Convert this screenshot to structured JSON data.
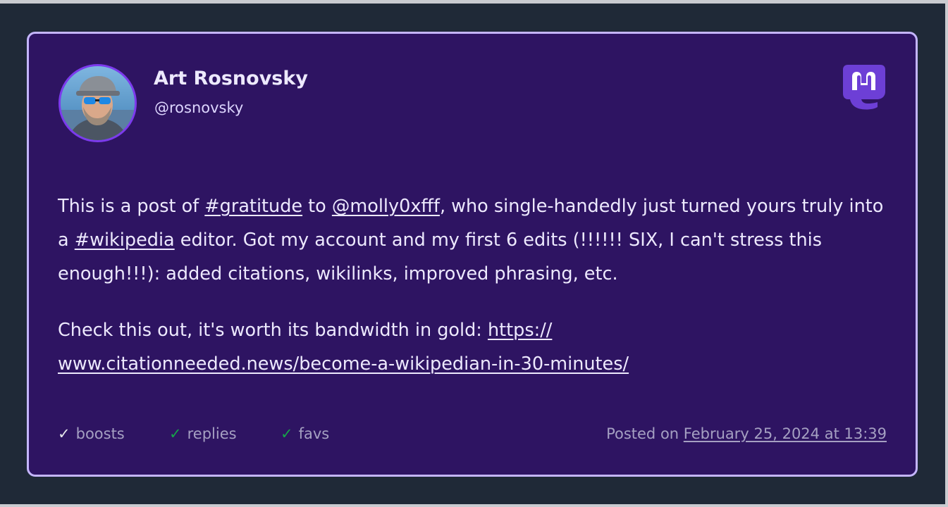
{
  "author": {
    "display_name": "Art Rosnovsky",
    "handle": "@rosnovsky"
  },
  "logo_icon": "mastodon-icon",
  "post": {
    "paragraph1": {
      "t1": "This is a post of ",
      "hashtag1": "#gratitude",
      "t2": " to ",
      "mention": "@molly0xfff",
      "t3": ", who single-handedly just turned yours truly into a ",
      "hashtag2": "#wikipedia",
      "t4": " editor. Got my account and my first 6 edits (!!!!!! SIX, I can't stress this enough!!!): added citations, wikilinks, improved phrasing, etc."
    },
    "paragraph2": {
      "t1": "Check this out, it's worth its bandwidth in gold: ",
      "link_line1": "https://",
      "link_line2": "www.citationneeded.news/become-a-wikipedian-in-30-minutes/"
    }
  },
  "footer": {
    "boosts_label": "boosts",
    "replies_label": "replies",
    "favs_label": "favs",
    "check_glyph": "✓",
    "posted_prefix": "Posted on ",
    "posted_date": "February 25, 2024 at 13:39"
  },
  "colors": {
    "card_background": "#2e1462",
    "card_border": "#c4b5fd",
    "page_background": "#1f2937",
    "brand": "#6d3fd6",
    "check_green": "#16a34a"
  }
}
